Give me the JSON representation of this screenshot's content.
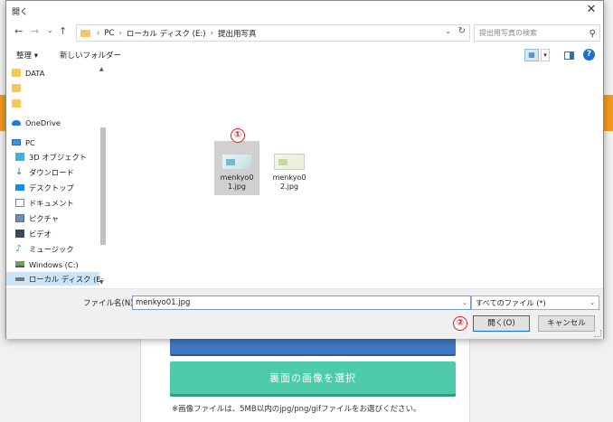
{
  "background": {
    "green_button_label": "裏面の画像を選択",
    "note": "※画像ファイルは、5MB以内のjpg/png/gifファイルをお選びください。"
  },
  "dialog": {
    "title": "開く",
    "close_glyph": "✕",
    "nav": {
      "back": "←",
      "forward": "→",
      "recent": "⌄",
      "up": "↑"
    },
    "breadcrumbs": [
      "PC",
      "ローカル ディスク (E:)",
      "提出用写真"
    ],
    "breadcrumb_sep": "›",
    "refresh_glyph": "↻",
    "search_placeholder": "提出用写真の検索",
    "toolbar": {
      "organize": "整理 ▾",
      "new_folder": "新しいフォルダー",
      "help": "?"
    },
    "nav_items": [
      {
        "label": "DATA",
        "icon": "folder-icon"
      },
      {
        "label": "",
        "icon": "folder-icon"
      },
      {
        "label": "",
        "icon": "folder-icon"
      },
      {
        "label": "OneDrive",
        "icon": "cloud-icon"
      },
      {
        "label": "PC",
        "icon": "pc-icon"
      },
      {
        "label": "3D オブジェクト",
        "icon": "cube-icon"
      },
      {
        "label": "ダウンロード",
        "icon": "download-icon"
      },
      {
        "label": "デスクトップ",
        "icon": "desktop-icon"
      },
      {
        "label": "ドキュメント",
        "icon": "document-icon"
      },
      {
        "label": "ピクチャ",
        "icon": "picture-icon"
      },
      {
        "label": "ビデオ",
        "icon": "video-icon"
      },
      {
        "label": "ミュージック",
        "icon": "music-icon"
      },
      {
        "label": "Windows (C:)",
        "icon": "windows-drive-icon"
      },
      {
        "label": "ローカル ディスク (E:",
        "icon": "drive-icon"
      }
    ],
    "files": [
      {
        "name": "menkyo01.jpg",
        "selected": true
      },
      {
        "name": "menkyo02.jpg",
        "selected": false
      }
    ],
    "markers": [
      "①",
      "②"
    ],
    "filename_label": "ファイル名(N):",
    "filename_value": "menkyo01.jpg",
    "filetype_value": "すべてのファイル (*)",
    "open_button": "開く(O)",
    "cancel_button": "キャンセル"
  },
  "colors": {
    "accent_blue": "#0078d7",
    "marker_red": "#e8151c",
    "orange_band": "#f29a1d",
    "green_button": "#4ecba8",
    "blue_button": "#3f78c4"
  }
}
